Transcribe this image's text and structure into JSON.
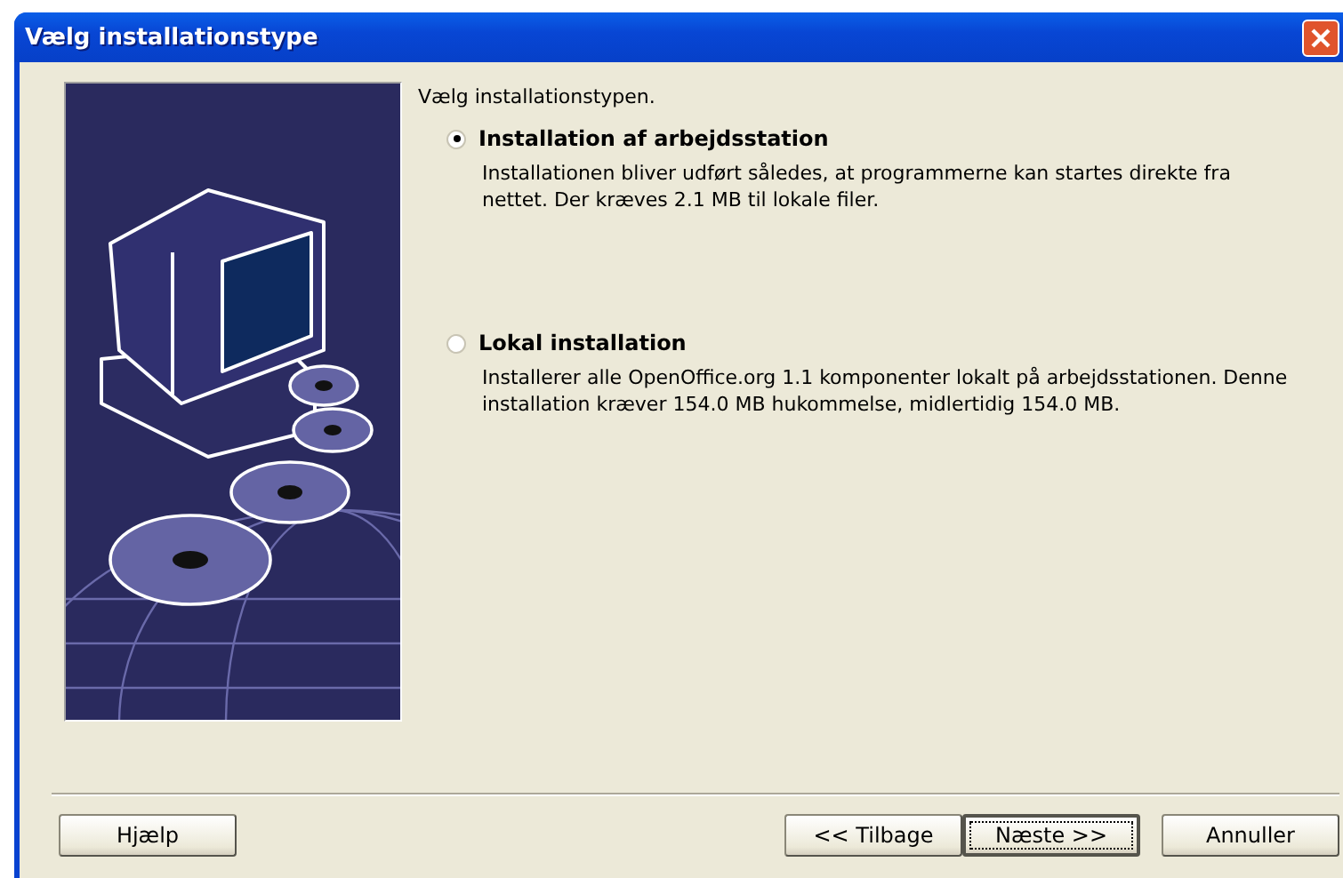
{
  "window": {
    "title": "Vælg installationstype"
  },
  "prompt": "Vælg installationstypen.",
  "options": [
    {
      "label": "Installation af arbejdsstation",
      "description": "Installationen bliver udført således, at programmerne kan startes direkte fra nettet. Der kræves 2.1 MB til lokale filer.",
      "selected": true
    },
    {
      "label": "Lokal installation",
      "description": "Installerer alle OpenOffice.org 1.1 komponenter lokalt på arbejdsstationen. Denne installation kræver 154.0 MB hukommelse, midlertidig 154.0 MB.",
      "selected": false
    }
  ],
  "buttons": [
    {
      "label": "Hjælp",
      "focused": false
    },
    {
      "label": "<< Tilbage",
      "focused": false
    },
    {
      "label": "Næste >>",
      "focused": true
    },
    {
      "label": "Annuller",
      "focused": false
    }
  ]
}
